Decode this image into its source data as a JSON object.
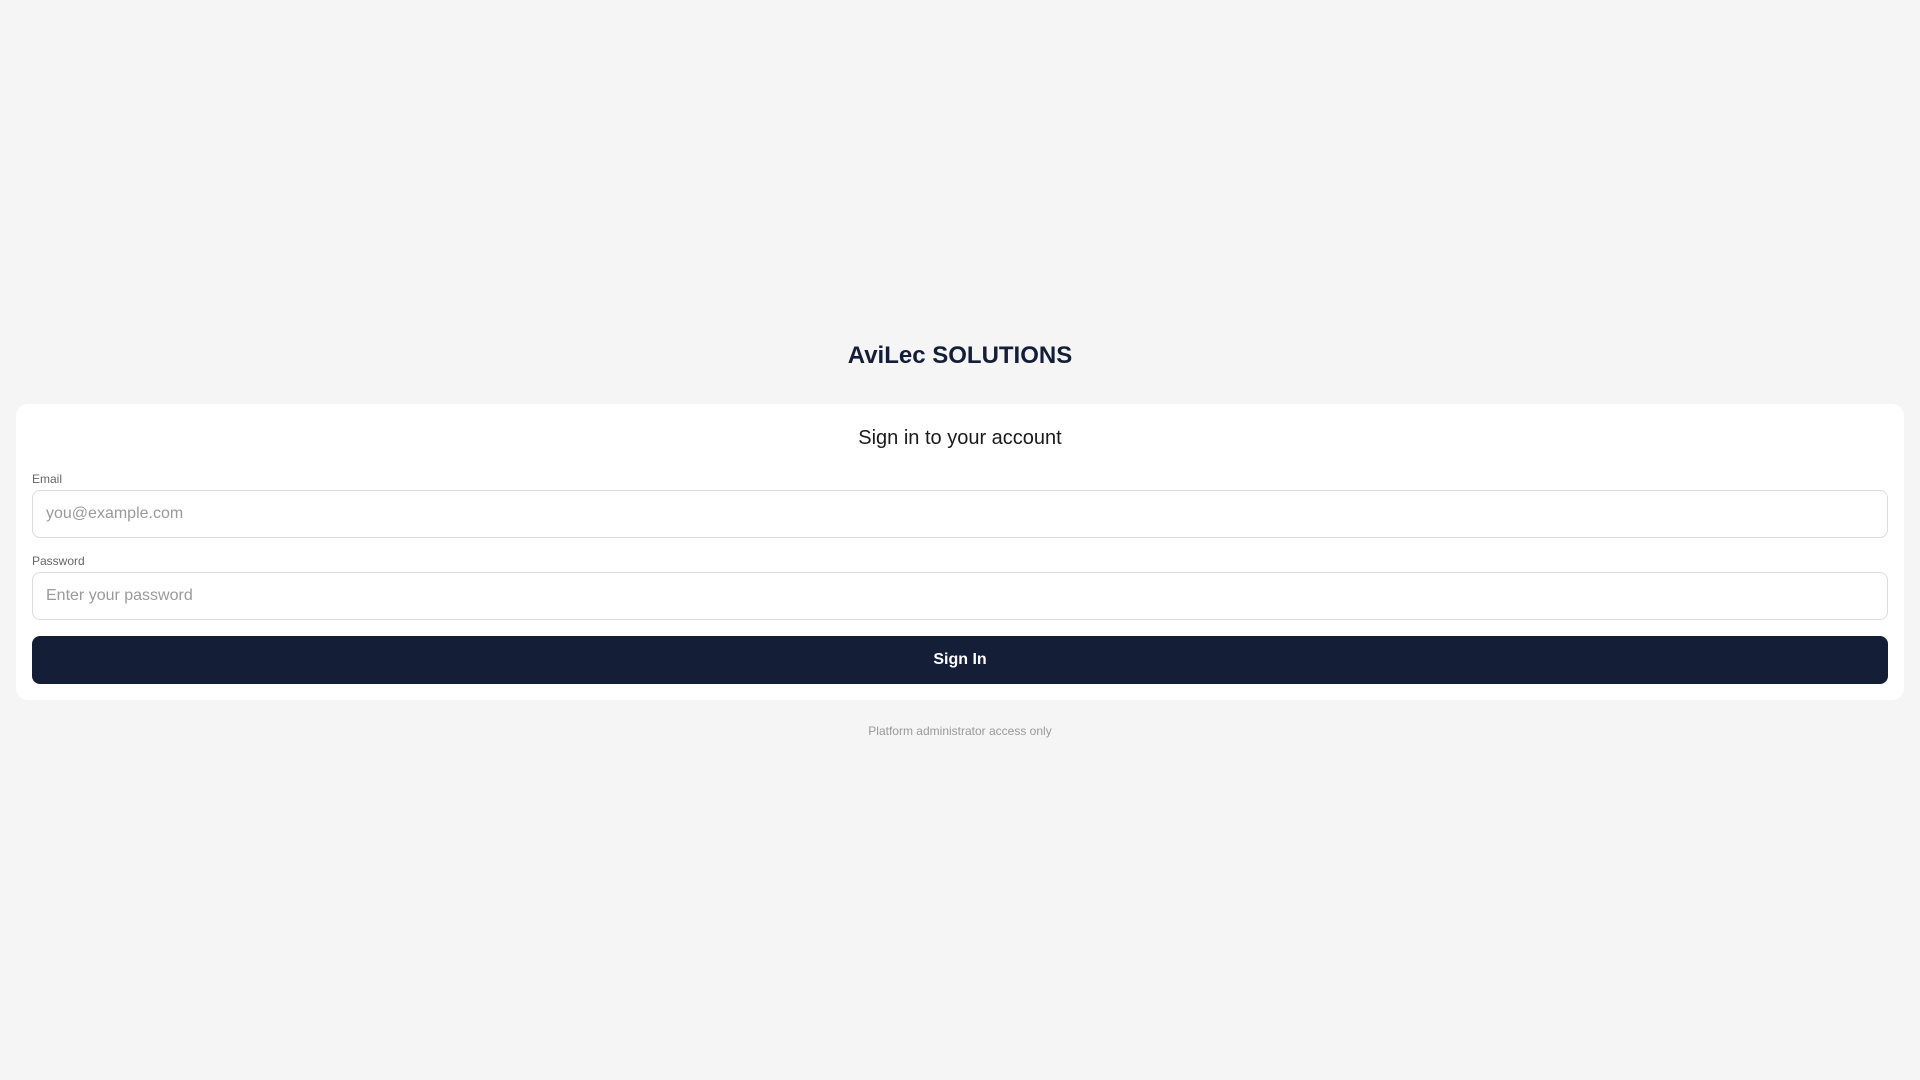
{
  "brand": {
    "name": "AviLec SOLUTIONS",
    "color": "#141e36"
  },
  "login_card": {
    "title": "Sign in to your account",
    "email": {
      "label": "Email",
      "placeholder": "you@example.com",
      "value": ""
    },
    "password": {
      "label": "Password",
      "placeholder": "Enter your password",
      "value": ""
    },
    "submit_label": "Sign In",
    "button_color": "#141e36"
  },
  "footer": {
    "note": "Platform administrator access only"
  }
}
